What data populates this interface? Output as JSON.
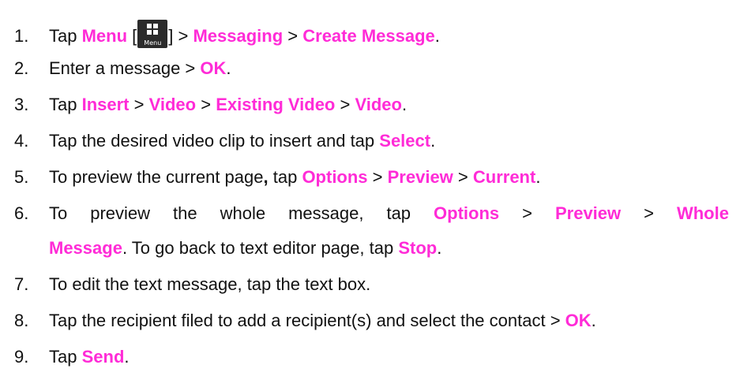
{
  "steps": [
    {
      "num": "1.",
      "t1": "Tap ",
      "k1": "Menu",
      "t2": " [",
      "icon_label": "Menu",
      "t3": "] > ",
      "k2": "Messaging",
      "t4": " > ",
      "k3": "Create Message",
      "t5": "."
    },
    {
      "num": "2.",
      "t1": "Enter a message > ",
      "k1": "OK",
      "t2": "."
    },
    {
      "num": "3.",
      "t1": "Tap ",
      "k1": "Insert",
      "t2": " > ",
      "k2": "Video",
      "t3": " > ",
      "k3": "Existing Video",
      "t4": " > ",
      "k4": "Video",
      "t5": "."
    },
    {
      "num": "4.",
      "t1": "Tap the desired video clip to insert and tap ",
      "k1": "Select",
      "t2": "."
    },
    {
      "num": "5.",
      "t1": "To preview the current page",
      "t1b": ",",
      "t1c": " tap ",
      "k1": "Options",
      "t2": " > ",
      "k2": "Preview",
      "t3": " > ",
      "k3": "Current",
      "t4": "."
    },
    {
      "num": "6.",
      "w": [
        "To",
        "preview",
        "the",
        "whole",
        "message,",
        "tap"
      ],
      "k1": "Options",
      "g1": ">",
      "k2": "Preview",
      "g2": ">",
      "k3": "Whole",
      "k4": "Message",
      "t2": ". To go back to text editor page, tap ",
      "k5": "Stop",
      "t3": "."
    },
    {
      "num": "7.",
      "t1": "To edit the text message, tap the text box."
    },
    {
      "num": "8.",
      "t1": "Tap the recipient filed to add a recipient(s) and select the contact > ",
      "k1": "OK",
      "t2": "."
    },
    {
      "num": "9.",
      "t1": "Tap ",
      "k1": "Send",
      "t2": "."
    }
  ],
  "colors": {
    "keyword": "#ff2bd7",
    "text": "#111111",
    "icon_bg": "#2b2b2b"
  },
  "icons": {
    "menu": "windows-grid-menu-icon"
  }
}
